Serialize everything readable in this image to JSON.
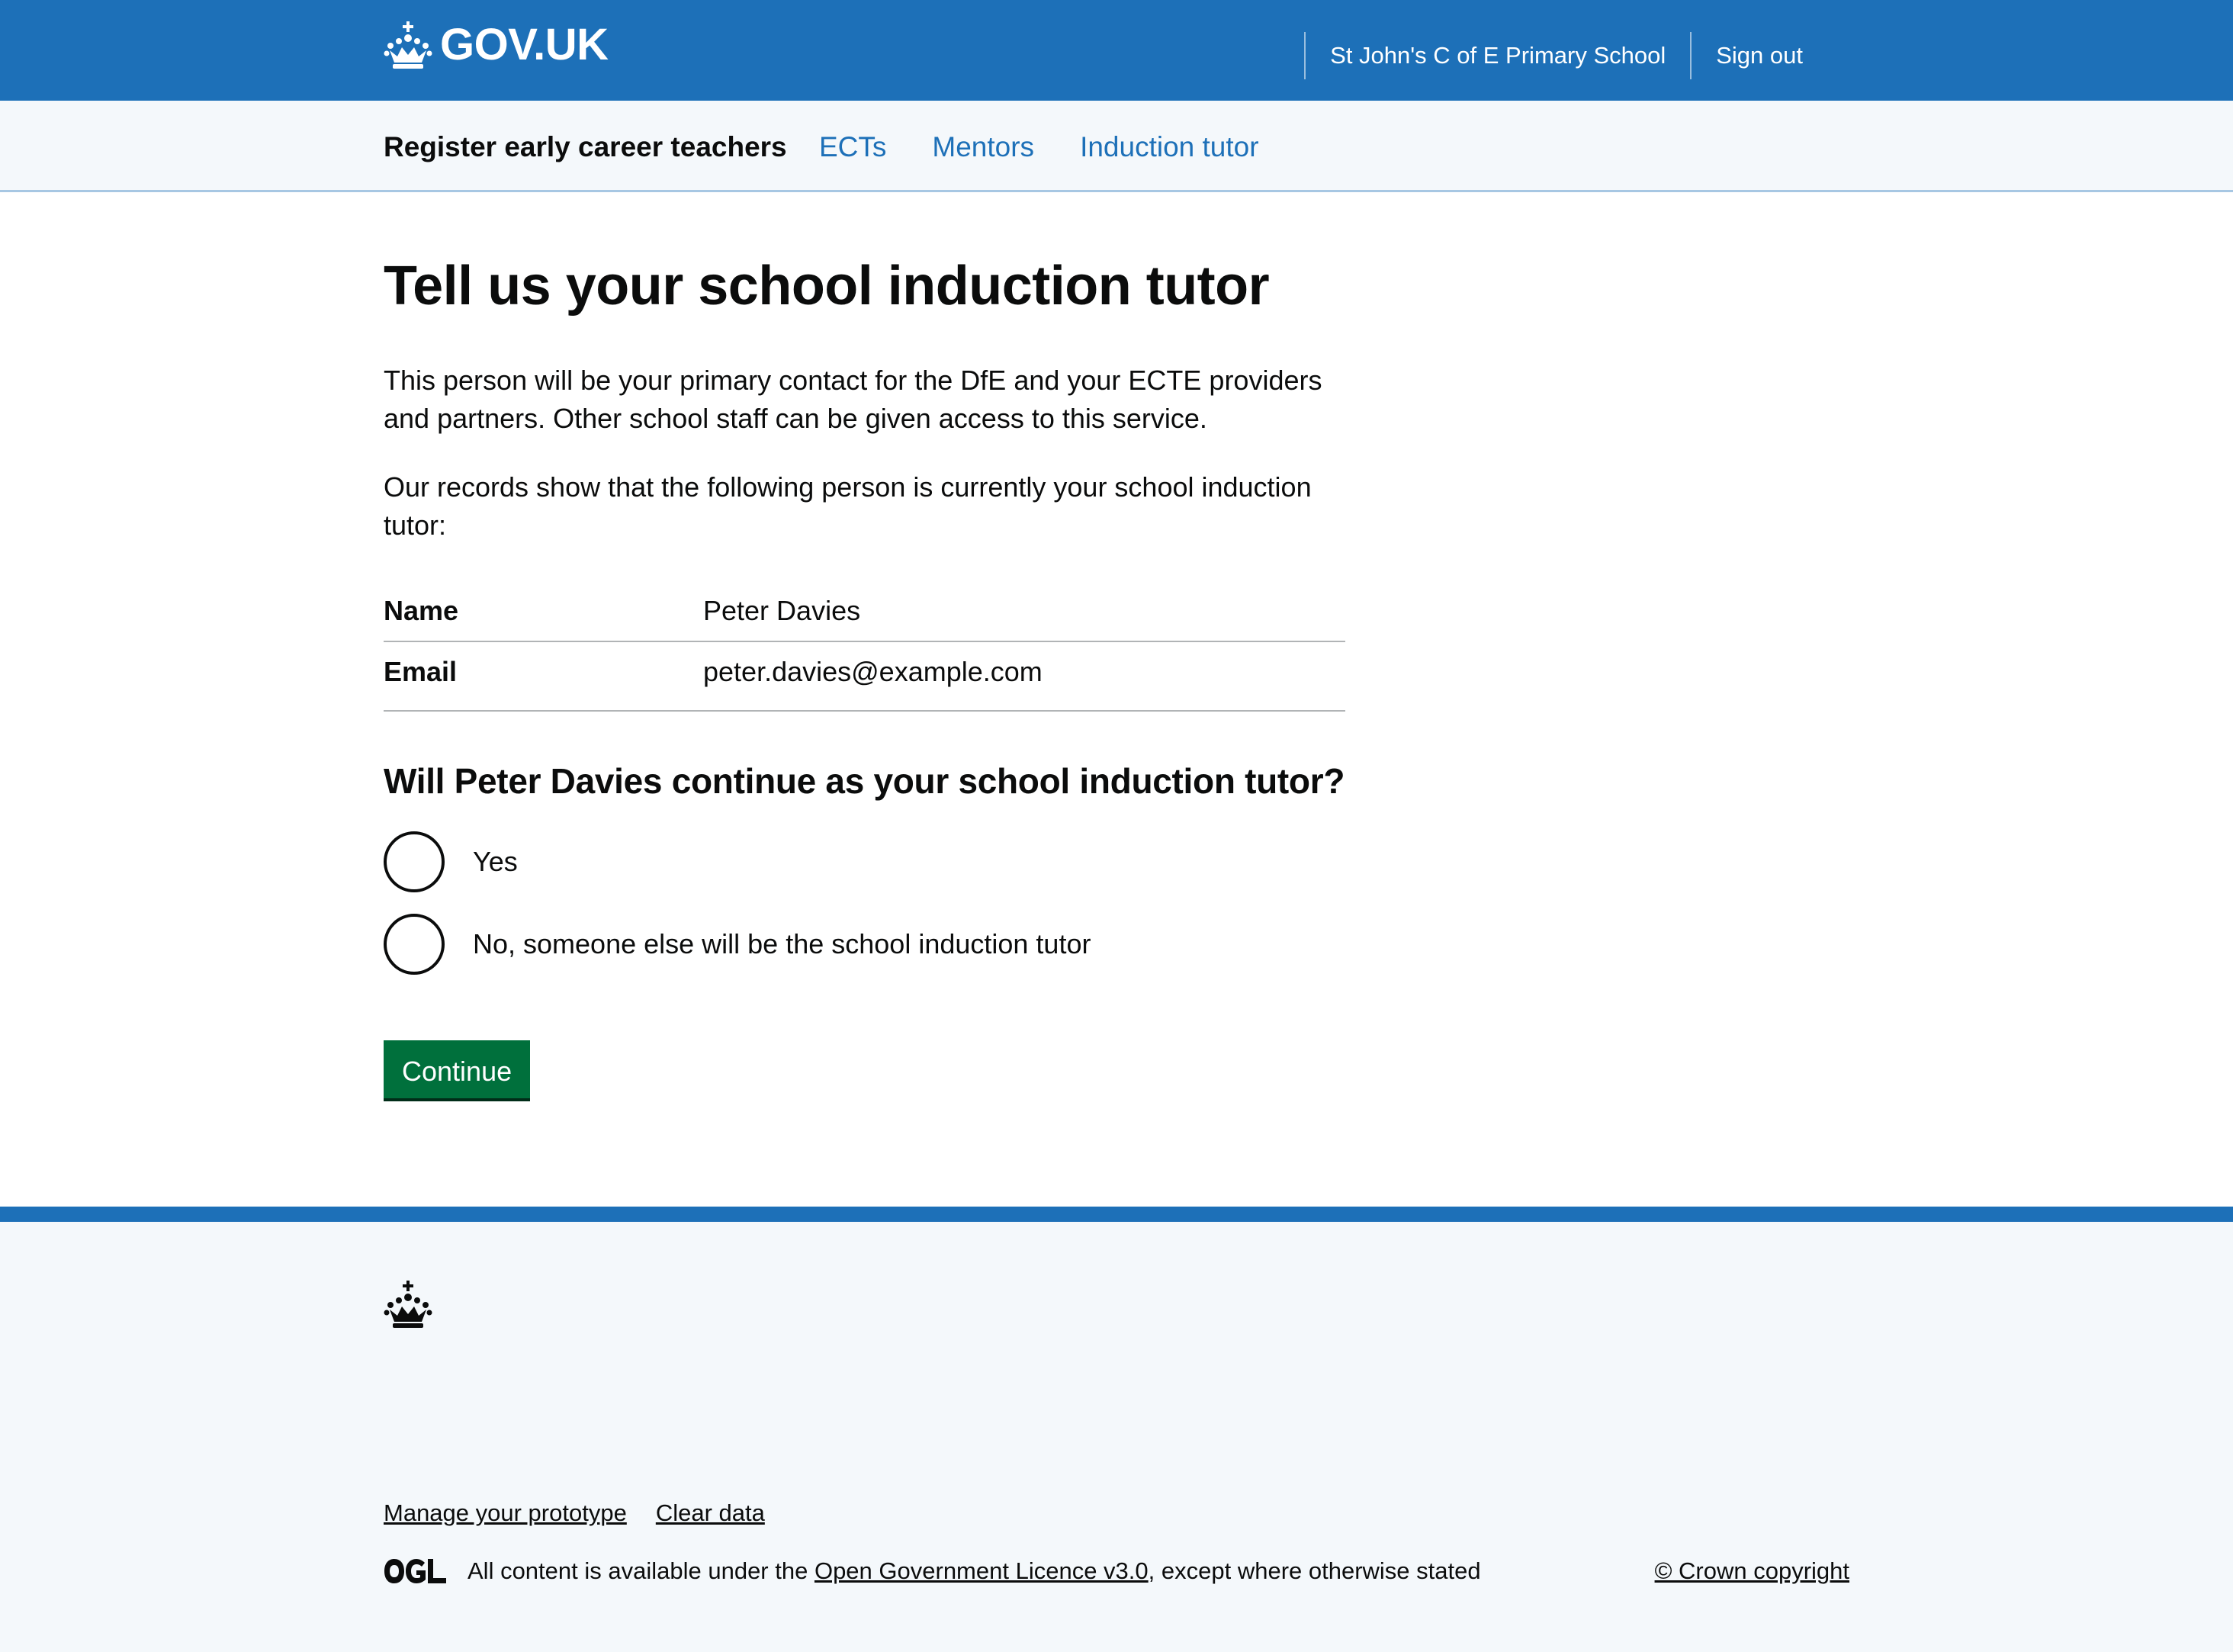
{
  "header": {
    "logo_text": "GOV.UK",
    "school_name": "St John's C of E Primary School",
    "sign_out": "Sign out"
  },
  "service_nav": {
    "service_name": "Register early career teachers",
    "links": [
      "ECTs",
      "Mentors",
      "Induction tutor"
    ]
  },
  "main": {
    "title": "Tell us your school induction tutor",
    "paragraph_1": "This person will be your primary contact for the DfE and your ECTE providers and partners. Other school staff can be given access to this service.",
    "paragraph_2": "Our records show that the following person is currently your school induction tutor:",
    "summary": [
      {
        "key": "Name",
        "value": "Peter Davies"
      },
      {
        "key": "Email",
        "value": "peter.davies@example.com"
      }
    ],
    "question": "Will Peter Davies continue as your school induction tutor?",
    "options": [
      "Yes",
      "No, someone else will be the school induction tutor"
    ],
    "continue_button": "Continue"
  },
  "footer": {
    "links": [
      "Manage your prototype",
      "Clear data"
    ],
    "licence_prefix": "All content is available under the ",
    "licence_link": "Open Government Licence v3.0",
    "licence_suffix": ", except where otherwise stated",
    "copyright": "© Crown copyright"
  },
  "colors": {
    "header_blue": "#1d70b8",
    "link_blue": "#1d70b8",
    "button_green": "#00703c",
    "footer_background": "#f4f8fb",
    "text": "#0b0c0c"
  }
}
